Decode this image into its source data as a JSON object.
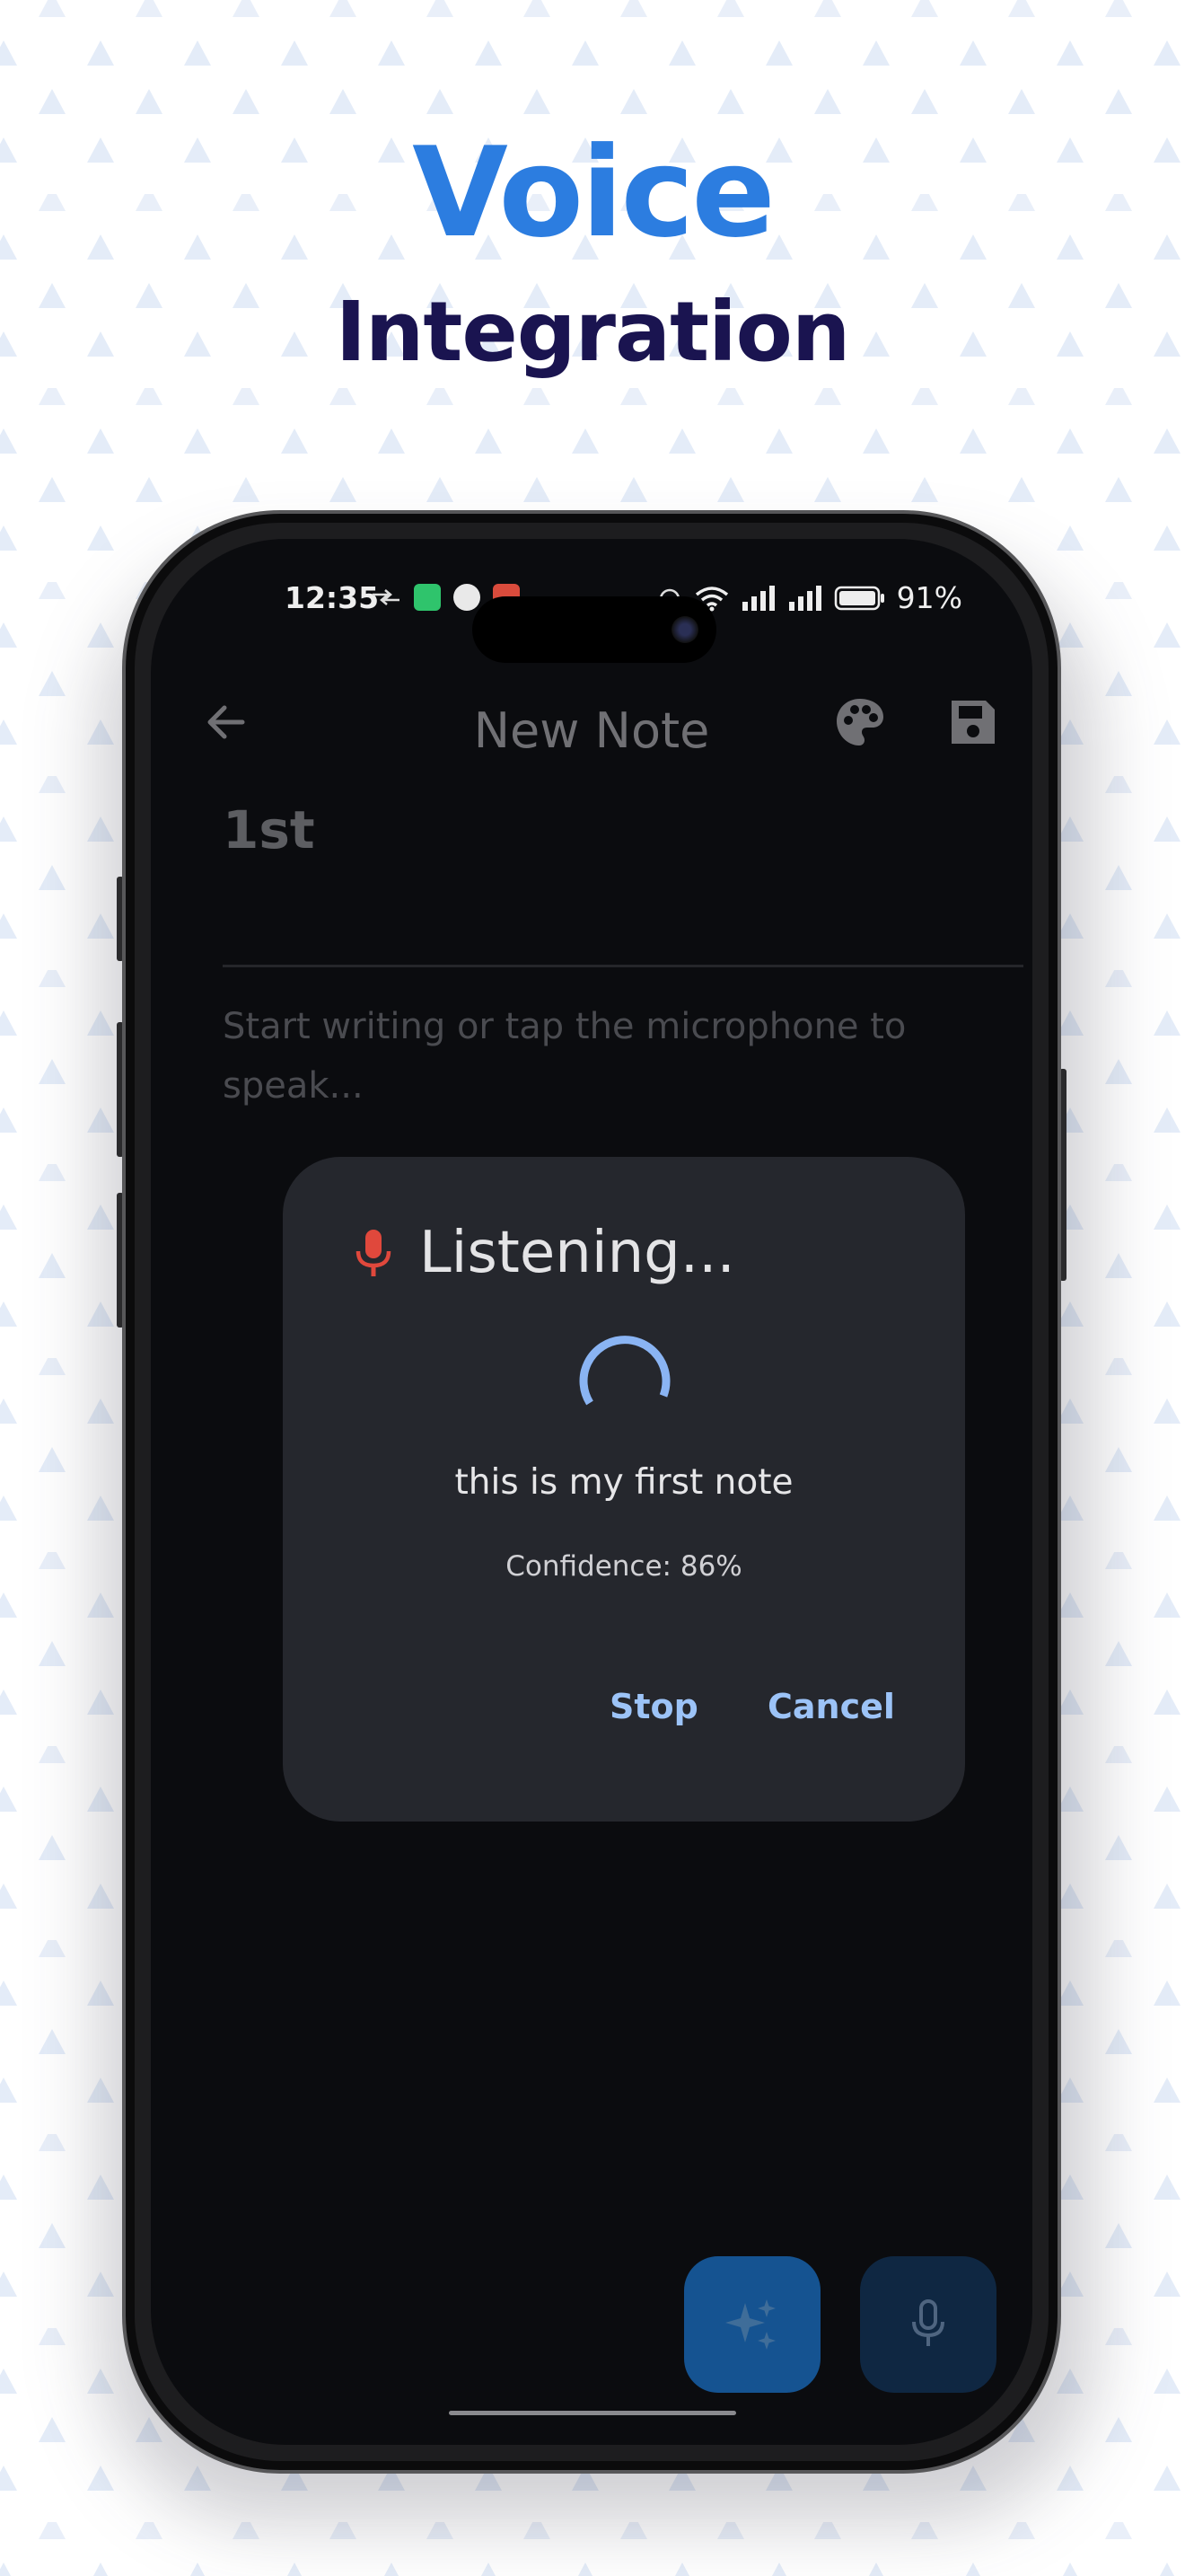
{
  "headline": {
    "line1": "Voice",
    "line2": "Integration"
  },
  "colors": {
    "headline_accent": "#2c7de0",
    "headline_dark": "#1a1450",
    "pattern_triangle": "#dde7f6",
    "mic_red": "#e0483c",
    "dialog_action": "#9cc3f7",
    "spinner": "#8ab4f3"
  },
  "status_bar": {
    "time": "12:35",
    "battery_percent": "91%"
  },
  "app_bar": {
    "title": "New Note",
    "back_icon": "arrow-back-icon",
    "palette_icon": "palette-icon",
    "save_icon": "save-icon"
  },
  "note": {
    "title": "1st",
    "body_placeholder": "Start writing or tap the microphone to speak..."
  },
  "dialog": {
    "title": "Listening...",
    "transcript": "this is my first note",
    "confidence": "Confidence: 86%",
    "stop_label": "Stop",
    "cancel_label": "Cancel"
  },
  "fabs": {
    "ai_icon": "sparkle-icon",
    "mic_icon": "microphone-icon"
  }
}
